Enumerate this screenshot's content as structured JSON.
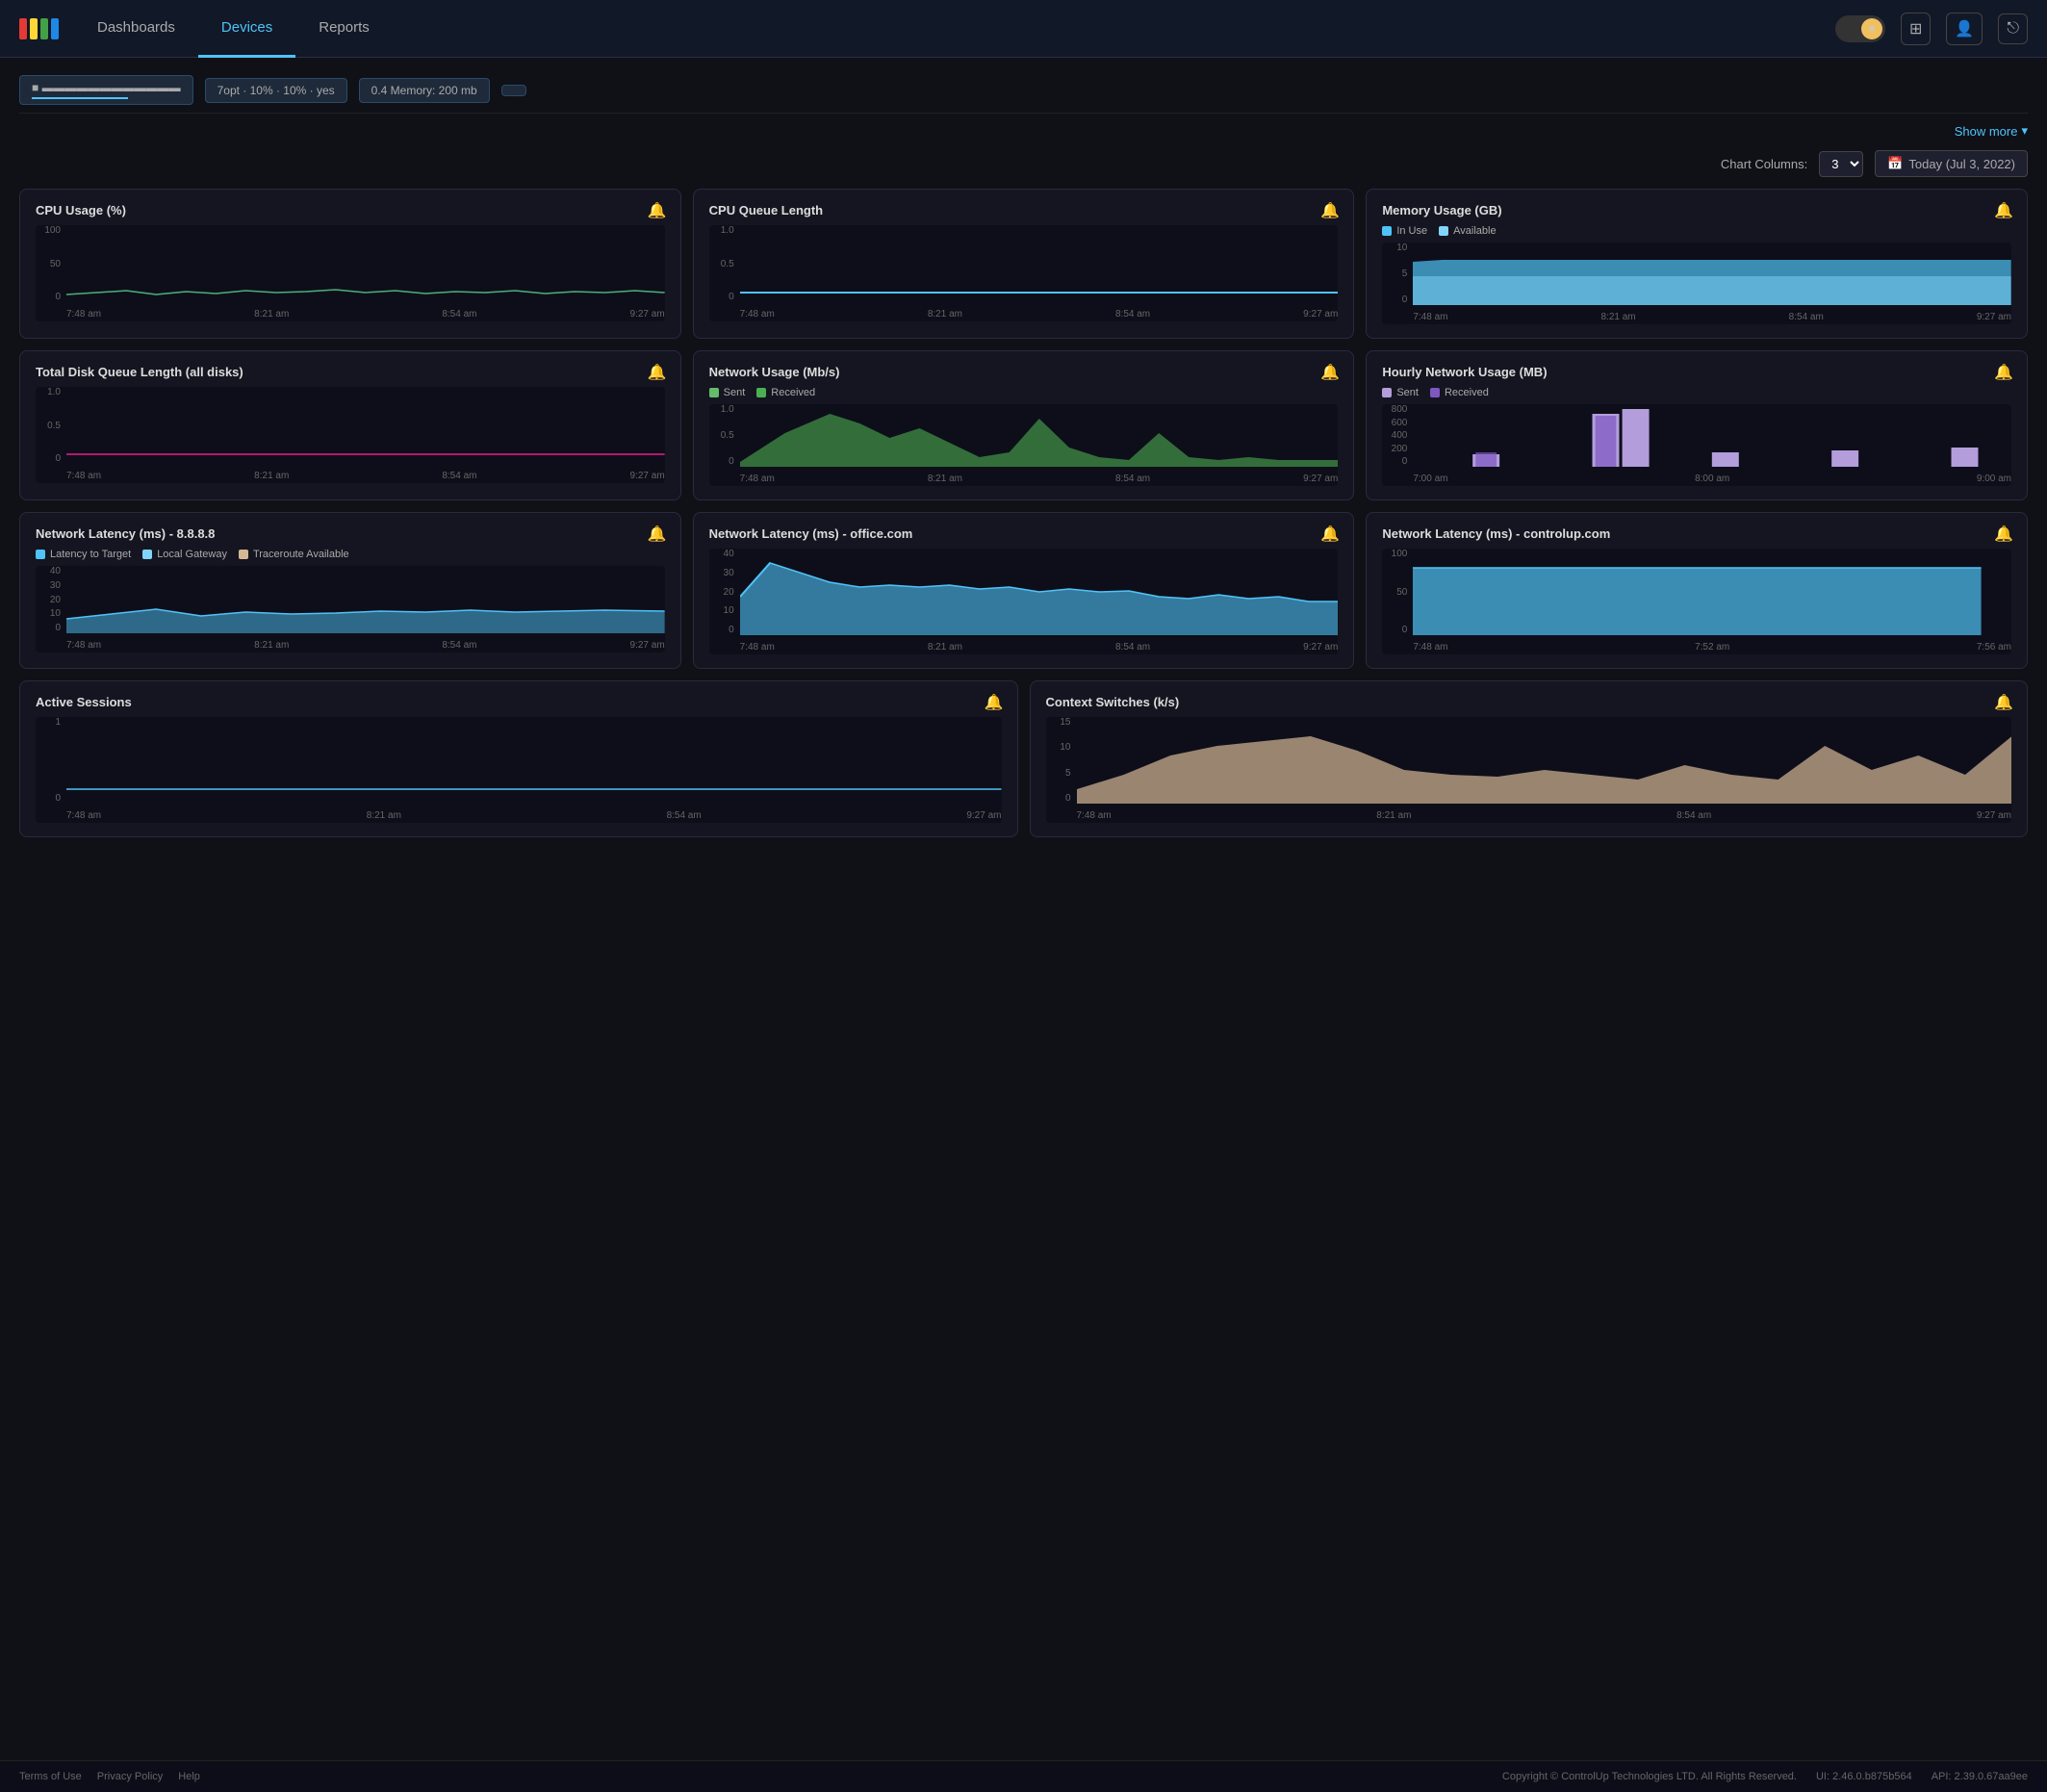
{
  "nav": {
    "dashboards_label": "Dashboards",
    "devices_label": "Devices",
    "reports_label": "Reports"
  },
  "topbar": {
    "show_more_label": "Show more",
    "chart_columns_label": "Chart Columns:",
    "columns_value": "3",
    "date_label": "Today (Jul 3, 2022)"
  },
  "charts": {
    "row1": [
      {
        "title": "CPU Usage (%)",
        "y_max": "100",
        "y_mid": "50",
        "y_min": "0",
        "color": "#4caf78",
        "type": "line",
        "times": [
          "7:48 am",
          "8:21 am",
          "8:54 am",
          "9:27 am"
        ]
      },
      {
        "title": "CPU Queue Length",
        "y_max": "1.0",
        "y_mid": "0.5",
        "y_min": "0",
        "color": "#4fc3f7",
        "type": "line",
        "times": [
          "7:48 am",
          "8:21 am",
          "8:54 am",
          "9:27 am"
        ]
      },
      {
        "title": "Memory Usage (GB)",
        "y_max": "10",
        "y_mid": "5",
        "y_min": "0",
        "legend": [
          {
            "label": "In Use",
            "color": "#4fc3f7"
          },
          {
            "label": "Available",
            "color": "#81d4fa"
          }
        ],
        "type": "area",
        "times": [
          "7:48 am",
          "8:21 am",
          "8:54 am",
          "9:27 am"
        ]
      }
    ],
    "row2": [
      {
        "title": "Total Disk Queue Length (all disks)",
        "y_max": "1.0",
        "y_mid": "0.5",
        "y_min": "0",
        "color": "#e91e8c",
        "type": "line",
        "times": [
          "7:48 am",
          "8:21 am",
          "8:54 am",
          "9:27 am"
        ]
      },
      {
        "title": "Network Usage (Mb/s)",
        "y_max": "1.0",
        "y_mid": "0.5",
        "y_min": "0",
        "legend": [
          {
            "label": "Sent",
            "color": "#66bb6a"
          },
          {
            "label": "Received",
            "color": "#4caf50"
          }
        ],
        "type": "area",
        "times": [
          "7:48 am",
          "8:21 am",
          "8:54 am",
          "9:27 am"
        ]
      },
      {
        "title": "Hourly Network Usage (MB)",
        "y_max": "800",
        "y_mid": "400",
        "y_min": "0",
        "legend": [
          {
            "label": "Sent",
            "color": "#b39ddb"
          },
          {
            "label": "Received",
            "color": "#7e57c2"
          }
        ],
        "type": "bar",
        "times": [
          "7:00 am",
          "8:00 am",
          "9:00 am"
        ]
      }
    ],
    "row3": [
      {
        "title": "Network Latency (ms) - 8.8.8.8",
        "y_max": "40",
        "y_mid": "20",
        "y_min": "0",
        "legend": [
          {
            "label": "Latency to Target",
            "color": "#4fc3f7"
          },
          {
            "label": "Local Gateway",
            "color": "#81d4fa"
          },
          {
            "label": "Traceroute Available",
            "color": "#d4b896"
          }
        ],
        "type": "area",
        "extra_y": [
          "30",
          "10"
        ],
        "times": [
          "7:48 am",
          "8:21 am",
          "8:54 am",
          "9:27 am"
        ]
      },
      {
        "title": "Network Latency (ms) - office.com",
        "y_max": "40",
        "y_mid": "20",
        "y_min": "0",
        "color": "#4fc3f7",
        "type": "area",
        "extra_y": [
          "30",
          "10"
        ],
        "times": [
          "7:48 am",
          "8:21 am",
          "8:54 am",
          "9:27 am"
        ]
      },
      {
        "title": "Network Latency (ms) - controlup.com",
        "y_max": "100",
        "y_mid": "50",
        "y_min": "0",
        "color": "#4fc3f7",
        "type": "area",
        "times": [
          "7:48 am",
          "7:52 am",
          "7:56 am"
        ]
      }
    ],
    "row4": [
      {
        "title": "Active Sessions",
        "y_max": "1",
        "y_min": "0",
        "color": "#4fc3f7",
        "type": "line",
        "times": [
          "7:48 am",
          "8:21 am",
          "8:54 am",
          "9:27 am"
        ]
      },
      {
        "title": "Context Switches (k/s)",
        "y_max": "15",
        "y_mid": "10",
        "y_min": "0",
        "color": "#d4b896",
        "type": "area",
        "extra_y": [
          "5"
        ],
        "times": [
          "7:48 am",
          "8:21 am",
          "8:54 am",
          "9:27 am"
        ]
      }
    ]
  },
  "footer": {
    "terms": "Terms of Use",
    "privacy": "Privacy Policy",
    "help": "Help",
    "copyright": "Copyright © ControlUp Technologies LTD. All Rights Reserved.",
    "ui_version": "UI: 2.46.0.b875b564",
    "api_version": "API: 2.39.0.67aa9ee"
  }
}
